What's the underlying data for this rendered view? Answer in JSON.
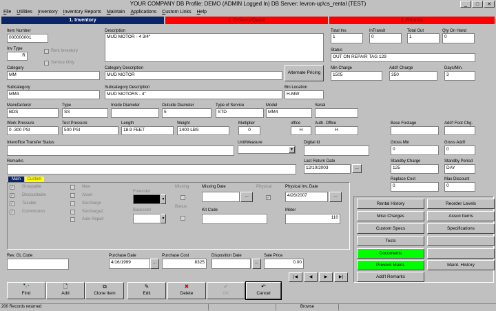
{
  "window": {
    "title": "YOUR COMPANY DB Profile: DEMO (ADMIN Logged In) DB Server: levron-up\\cs_rental  (TEST)",
    "min_glyph": "_",
    "max_glyph": "□",
    "close_glyph": "✕"
  },
  "menu": [
    "File",
    "Utilities",
    "Inventory",
    "Inventory Reports",
    "Maintain",
    "Applications",
    "Custom Links",
    "Help"
  ],
  "tabs": [
    {
      "label": "1. Inventory",
      "color": "#0a246a"
    },
    {
      "label": "2. Delivery/Quote",
      "color": "#ff0000"
    },
    {
      "label": "3. Returns",
      "color": "#ff0000"
    }
  ],
  "labels": {
    "item_number": "Item Number",
    "inv_type": "Inv Type",
    "rent_inventory": "Rent Inventory",
    "service_only": "Service Only",
    "description": "Description",
    "total_inv": "Total Inv.",
    "in_transit": "InTransit",
    "total_out": "Total Out",
    "qty_on_hand": "Qty On Hand",
    "status": "Status",
    "category": "Category",
    "category_description": "Category Description",
    "alternate_pricing": "Alternate Pricing",
    "min_charge": "Min Charge",
    "addl_charge": "Add'l Charge",
    "days_min": "Days/Min.",
    "subcategory": "Subcategory",
    "subcategory_description": "Subcategory Description",
    "bin_location": "Bin Location",
    "manufacturer": "Manufacturer",
    "type": "Type",
    "inside_diameter": "Inside Diameter",
    "outside_diameter": "Outside Diameter",
    "type_of_service": "Type of Service",
    "model": "Model",
    "serial": "Serial",
    "work_pressure": "Work Pressure",
    "test_pressure": "Test Pressure",
    "length": "Length",
    "weight": "Weight",
    "multiplier": "Multiplier",
    "office": "office",
    "auth_office": "Auth. Office",
    "base_footage": "Base Footage",
    "addl_foot_chg": "Add'l Foot Chg.",
    "interoffice": "Interoffice Transfer Status",
    "unit_measure": "Unit/Measure",
    "digital_id": "Digital Id",
    "gross_min": "Gross Min",
    "gross_addl": "Gross Add'l",
    "remarks": "Remarks",
    "last_return_date": "Last Return Date",
    "standby_charge": "Standby Charge",
    "standby_period": "Standby Period",
    "replace_cost": "Replace Cost",
    "max_discount": "Max Discount",
    "rev_gl": "Rev. GL Code",
    "purchase_date": "Purchase Date",
    "purchase_cost": "Purchase Cost",
    "disposition_date": "Disposition Date",
    "sale_price": "Sale Price"
  },
  "values": {
    "item_number": "000000001",
    "inv_type": "R",
    "description": "MUD MOTOR - 4 3/4\"",
    "total_inv": "1",
    "in_transit": "0",
    "total_out": "1",
    "qty_on_hand": "0",
    "status": "OUT ON REPAIR TAG 129",
    "category": "MM",
    "category_description": "MUD MOTOR",
    "min_charge": "1505",
    "addl_charge": "350",
    "days_min": "3",
    "subcategory": "MM4",
    "subcategory_description": "MUD MOTORS - 4\"",
    "bin_location": "H-MW",
    "manufacturer": "BDS",
    "type": "SS",
    "inside_diameter": "",
    "outside_diameter": "5",
    "type_of_service": "STD",
    "model": "MM4",
    "serial": "",
    "work_pressure": "0 -300 PSI",
    "test_pressure": "500 PSI",
    "length": "18.9 FEET",
    "weight": "1400 LBS",
    "multiplier": "0",
    "office": "H",
    "auth_office": "H",
    "base_footage": "",
    "addl_foot_chg": "",
    "interoffice": "",
    "unit_measure": "",
    "digital_id": "",
    "gross_min": "0",
    "gross_addl": "0",
    "remarks": "",
    "last_return_date": "12/10/2003",
    "standby_charge": "125",
    "standby_period": "DAY",
    "replace_cost": "0",
    "max_discount": "0",
    "rev_gl": "",
    "purchase_date": "4/16/1999",
    "purchase_cost": "8325",
    "disposition_date": "",
    "sale_price": "0.00"
  },
  "subtabs": [
    "Main",
    "Custom"
  ],
  "checks_left": [
    {
      "label": "Groupable",
      "checked": true
    },
    {
      "label": "Discountable",
      "checked": true
    },
    {
      "label": "Taxable",
      "checked": true
    },
    {
      "label": "Commission",
      "checked": true
    }
  ],
  "checks_mid": [
    {
      "label": "New",
      "checked": false
    },
    {
      "label": "Asset",
      "checked": false
    },
    {
      "label": "Surcharge",
      "checked": false
    },
    {
      "label": "Surcharge2",
      "checked": false
    },
    {
      "label": "Auto Repair",
      "checked": false
    }
  ],
  "main_panel": {
    "forecolor": "Forecolor",
    "backcolor": "Backcolor",
    "missing": "Missing",
    "bonus": "Bonus",
    "missing_date": "Missing Date",
    "physical": "Physical",
    "physical_inv_date": "Physical Inv. Date",
    "physical_inv_date_value": "4/26/2007",
    "kit_code": "Kit Code",
    "meter": "Meter",
    "meter_value": "110",
    "forecolor_value": "#000000",
    "backcolor_value": "#ffffff"
  },
  "right_buttons": [
    {
      "label": "Rental History",
      "color": "#c0c0c0"
    },
    {
      "label": "Reorder Levels",
      "color": "#c0c0c0"
    },
    {
      "label": "Misc Charges",
      "color": "#c0c0c0"
    },
    {
      "label": "Assoc Items",
      "color": "#c0c0c0"
    },
    {
      "label": "Custom Specs",
      "color": "#c0c0c0"
    },
    {
      "label": "Specifications",
      "color": "#c0c0c0"
    },
    {
      "label": "Tests",
      "color": "#c0c0c0"
    },
    {
      "label": "",
      "color": "#c0c0c0"
    },
    {
      "label": "Documents",
      "color": "#00ff00"
    },
    {
      "label": "",
      "color": "#c0c0c0"
    },
    {
      "label": "Prevent Maint.",
      "color": "#00ff00"
    },
    {
      "label": "Maint. History",
      "color": "#c0c0c0"
    },
    {
      "label": "Add'l Remarks",
      "color": "#c0c0c0"
    }
  ],
  "nav_glyphs": [
    "|◀",
    "◀",
    "▶",
    "▶|"
  ],
  "actions": [
    {
      "label": "Find",
      "icon": "binoculars-icon",
      "glyph": "🔭",
      "enabled": true
    },
    {
      "label": "Add",
      "icon": "new-document-icon",
      "glyph": "🗋",
      "enabled": true
    },
    {
      "label": "Clone Item",
      "icon": "clone-icon",
      "glyph": "⧉",
      "enabled": true
    },
    {
      "label": "Edit",
      "icon": "edit-icon",
      "glyph": "✎",
      "enabled": true
    },
    {
      "label": "Delete",
      "icon": "delete-icon",
      "glyph": "✖",
      "enabled": true
    },
    {
      "label": "OK",
      "icon": "check-icon",
      "glyph": "✔",
      "enabled": false
    },
    {
      "label": "Cancel",
      "icon": "undo-icon",
      "glyph": "↶",
      "enabled": true
    }
  ],
  "status_bar": {
    "records": "200 Records returned",
    "mode": "Browse"
  }
}
